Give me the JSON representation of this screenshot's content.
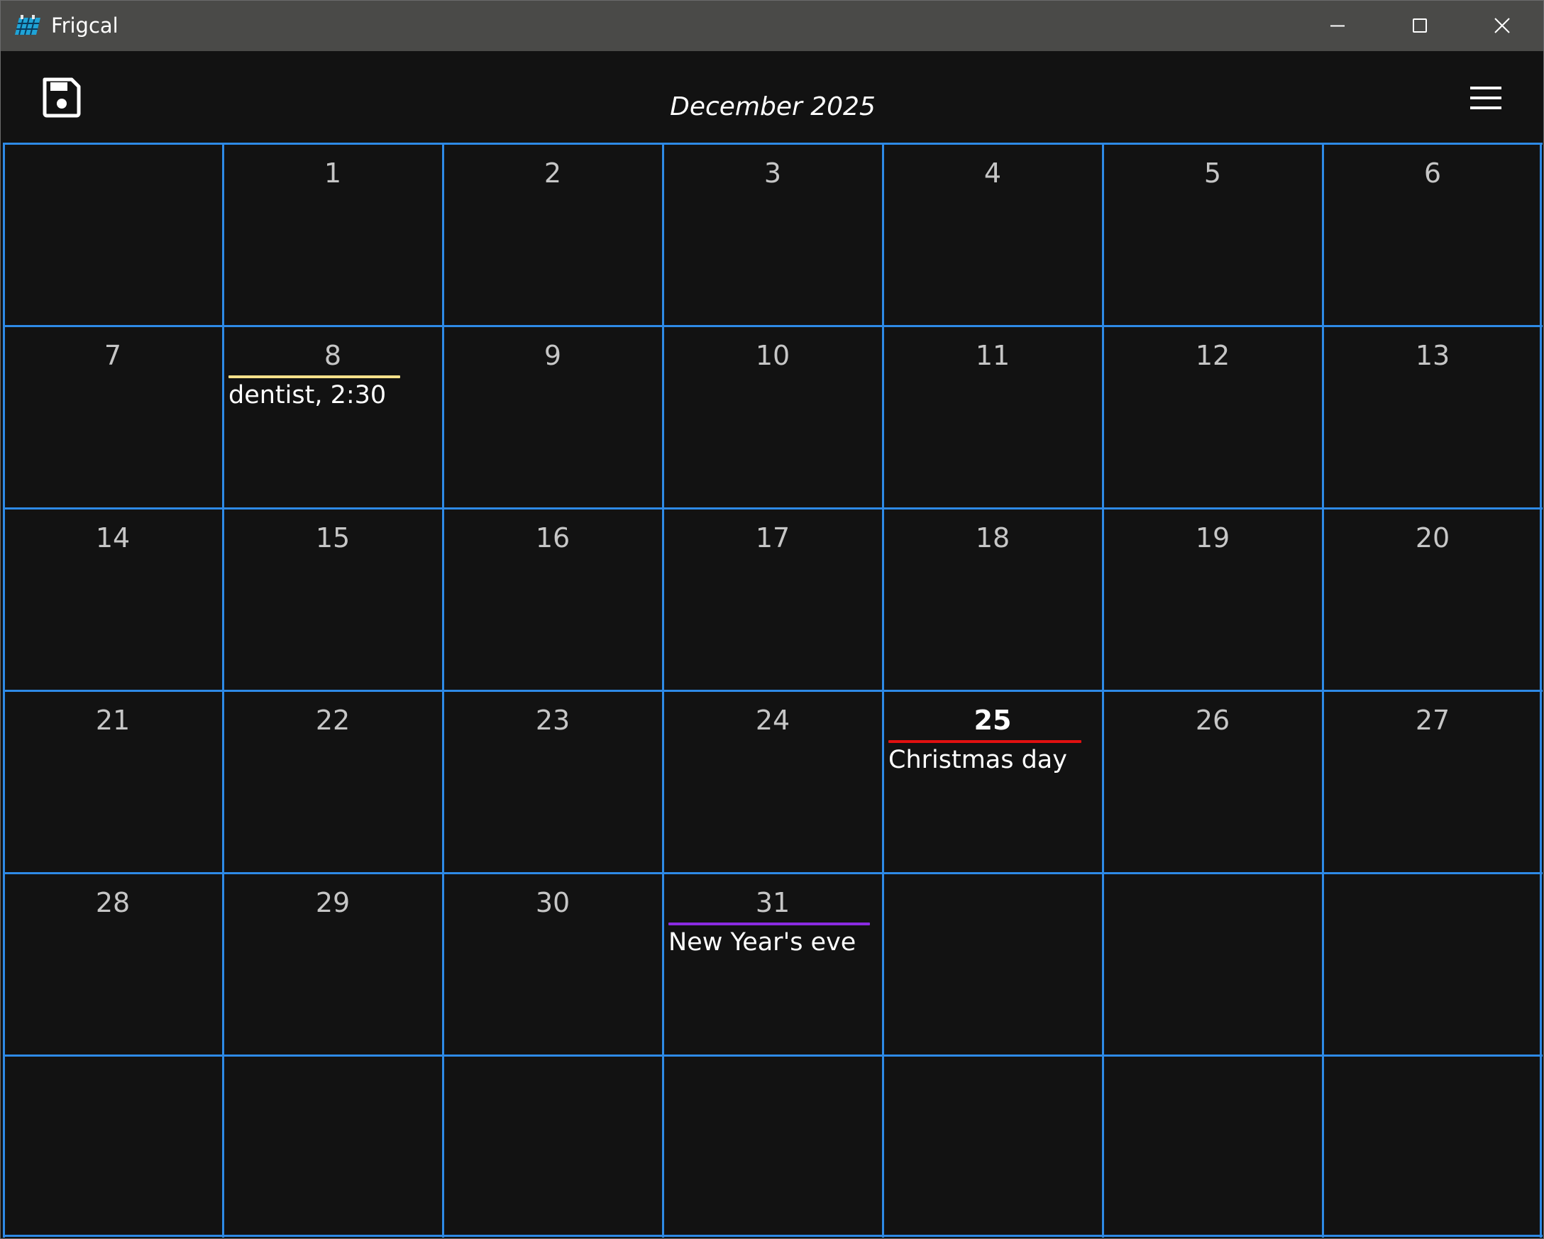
{
  "window": {
    "title": "Frigcal"
  },
  "toolbar": {
    "month_title": "December 2025"
  },
  "calendar": {
    "weeks": [
      [
        "",
        "1",
        "2",
        "3",
        "4",
        "5",
        "6"
      ],
      [
        "7",
        "8",
        "9",
        "10",
        "11",
        "12",
        "13"
      ],
      [
        "14",
        "15",
        "16",
        "17",
        "18",
        "19",
        "20"
      ],
      [
        "21",
        "22",
        "23",
        "24",
        "25",
        "26",
        "27"
      ],
      [
        "28",
        "29",
        "30",
        "31",
        "",
        "",
        ""
      ],
      [
        "",
        "",
        "",
        "",
        "",
        "",
        ""
      ]
    ],
    "today": "25",
    "events": [
      {
        "day": "8",
        "label": "dentist, 2:30",
        "color": "#f5e08a"
      },
      {
        "day": "25",
        "label": "Christmas day",
        "color": "#e01010"
      },
      {
        "day": "31",
        "label": "New Year's eve",
        "color": "#8a2be2"
      }
    ]
  },
  "colors": {
    "grid": "#2e8ae6",
    "background": "#121212",
    "titlebar": "#4a4a48"
  }
}
